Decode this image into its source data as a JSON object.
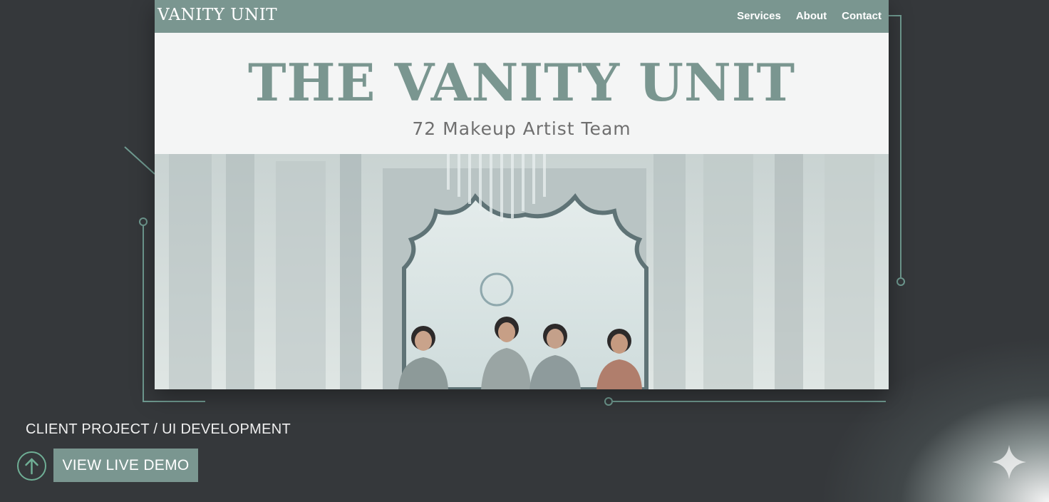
{
  "site": {
    "logo": "VANITY UNIT",
    "nav": [
      "Services",
      "About",
      "Contact"
    ],
    "hero_title": "THE VANITY UNIT",
    "hero_subtitle": "72 Makeup Artist Team"
  },
  "project": {
    "caption": "CLIENT PROJECT / UI DEVELOPMENT",
    "demo_button": "VIEW LIVE DEMO"
  },
  "colors": {
    "background": "#35383b",
    "accent_sage": "#7a9690",
    "line_green": "#6f9a90",
    "hero_bg": "#f4f5f5"
  },
  "icons": [
    "arrow-up-icon",
    "sparkle-icon"
  ]
}
